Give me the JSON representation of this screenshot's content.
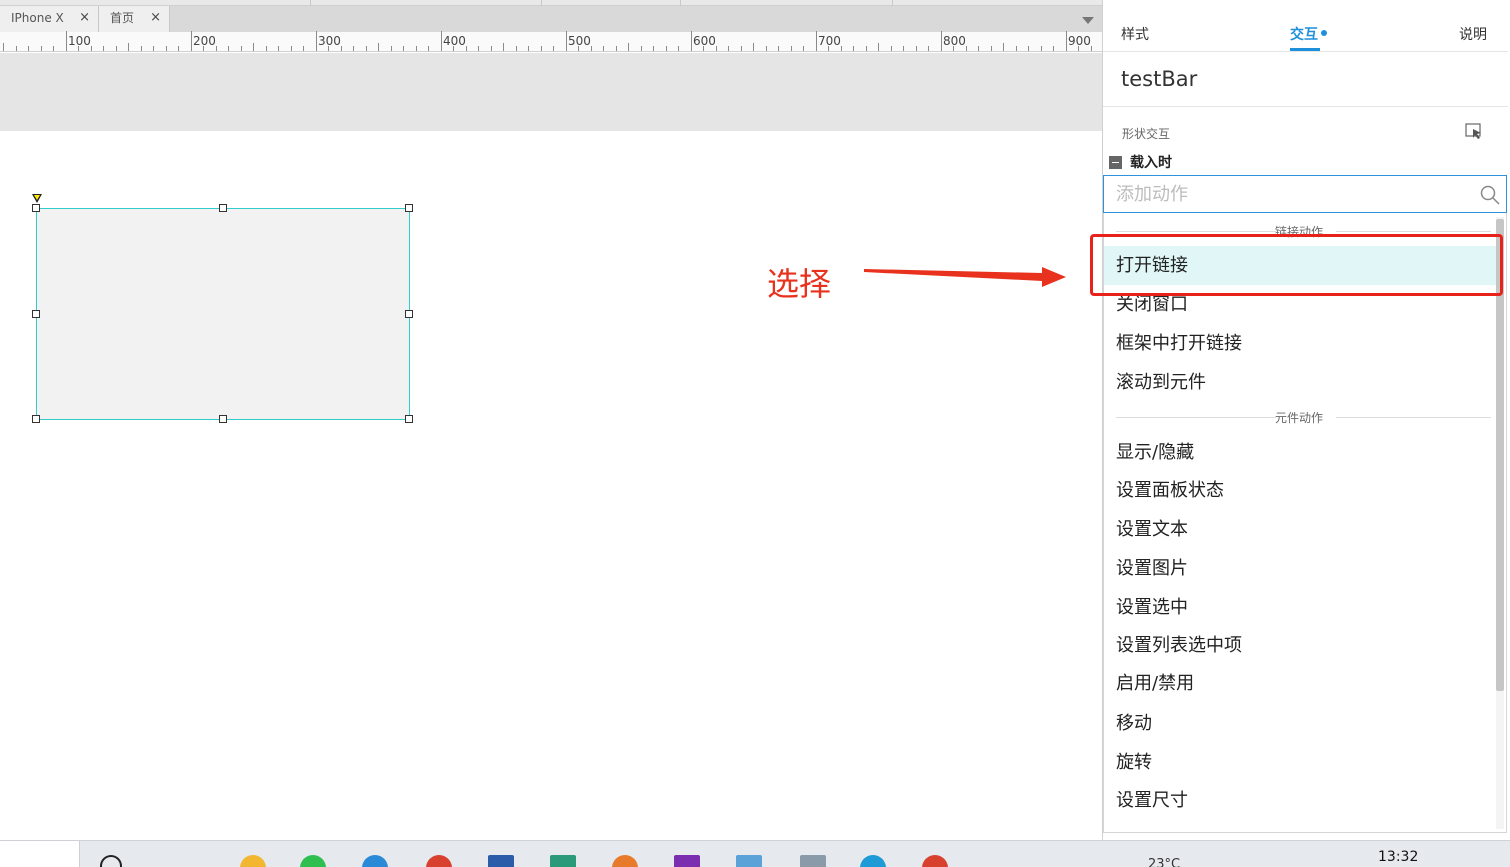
{
  "tabs": [
    {
      "label": "IPhone X",
      "close": "×"
    },
    {
      "label": "首页",
      "close": "×"
    }
  ],
  "ruler": {
    "labels": [
      "100",
      "200",
      "300",
      "400",
      "500",
      "600",
      "700",
      "800",
      "900"
    ]
  },
  "annotation": {
    "text": "选择"
  },
  "panel": {
    "tabs": {
      "style": "样式",
      "interaction": "交互",
      "notes": "说明"
    },
    "widget_name": "testBar",
    "section_label": "形状交互",
    "event_label": "载入时",
    "search": {
      "placeholder": "添加动作"
    },
    "groups": {
      "link": "链接动作",
      "widget": "元件动作"
    },
    "link_actions": [
      "打开链接",
      "关闭窗口",
      "框架中打开链接",
      "滚动到元件"
    ],
    "widget_actions": [
      "显示/隐藏",
      "设置面板状态",
      "设置文本",
      "设置图片",
      "设置选中",
      "设置列表选中项",
      "启用/禁用",
      "移动",
      "旋转",
      "设置尺寸"
    ],
    "selected_action": "打开链接"
  },
  "taskbar": {
    "clock": "13:32",
    "weather": "23°C"
  },
  "colors": {
    "accent": "#1e8fdb",
    "annotation": "#e8321e",
    "selection": "#33cccc",
    "highlight": "#e1f7f7"
  }
}
